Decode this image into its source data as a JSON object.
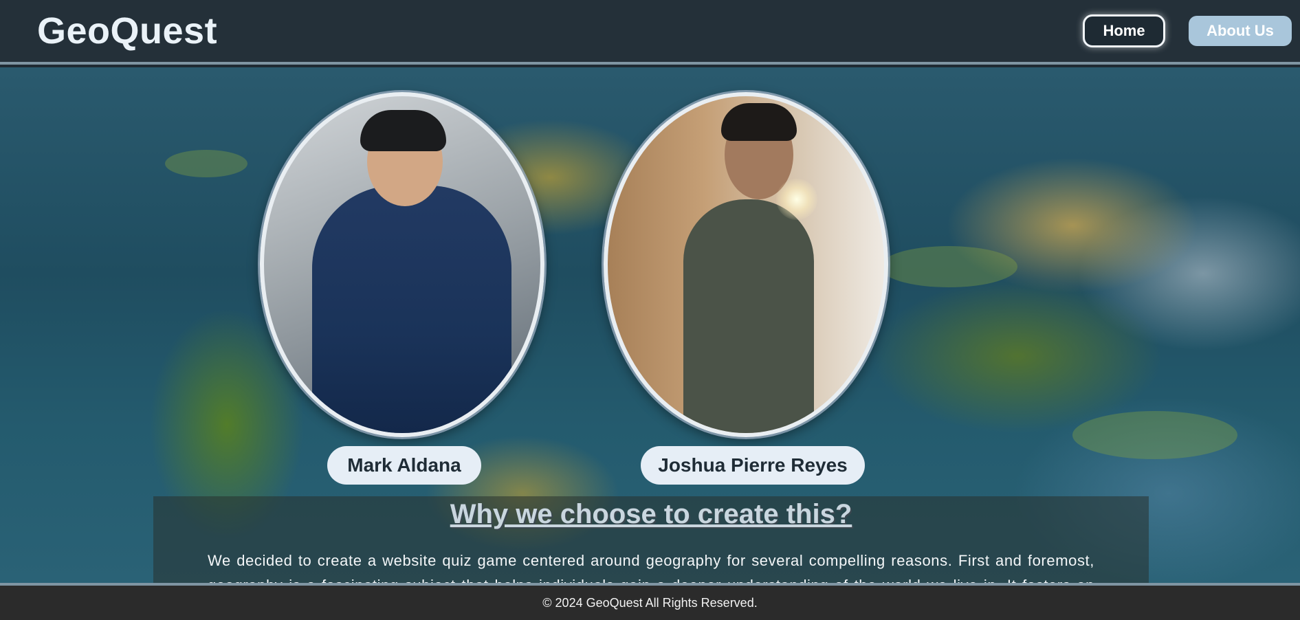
{
  "header": {
    "logo": "GeoQuest",
    "nav": {
      "home_label": "Home",
      "about_label": "About Us"
    }
  },
  "team": {
    "members": [
      {
        "name": "Mark Aldana"
      },
      {
        "name": "Joshua Pierre Reyes"
      }
    ]
  },
  "why_section": {
    "title": "Why we choose to create this?",
    "text": "We decided to create a website quiz game centered around geography for several compelling reasons. First and foremost, geography is a fascinating subject that helps individuals gain a deeper understanding of the world we live in. It fosters an awareness of"
  },
  "footer": {
    "text": "© 2024 GeoQuest All Rights Reserved."
  },
  "colors": {
    "header_bg": "#243039",
    "accent": "#a9c6db",
    "footer_bg": "#2b2b2b"
  }
}
